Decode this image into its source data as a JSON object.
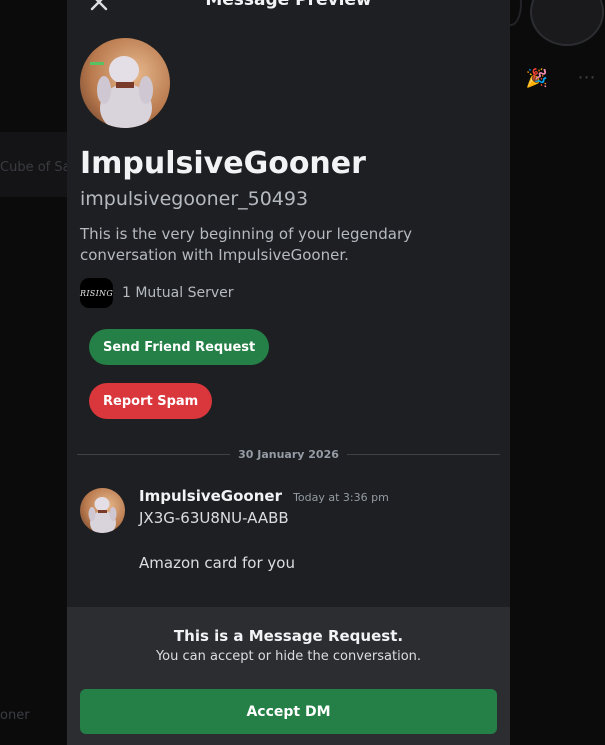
{
  "background": {
    "left_snippet": "Cube of Sa",
    "bottom_snippet": "oner"
  },
  "modal": {
    "title": "Message Preview",
    "close_icon": "close-icon"
  },
  "profile": {
    "display_name": "ImpulsiveGooner",
    "username": "impulsivegooner_50493",
    "intro": "This is the very beginning of your legendary conversation with ImpulsiveGooner.",
    "mutual_server_icon_text": "RISING",
    "mutual_servers": "1 Mutual Server"
  },
  "actions": {
    "send_friend_request": "Send Friend Request",
    "report_spam": "Report Spam"
  },
  "conversation": {
    "date_divider": "30 January 2026",
    "message": {
      "author": "ImpulsiveGooner",
      "timestamp": "Today at 3:36 pm",
      "line1": "JX3G-63U8NU-AABB",
      "line2": "Amazon card for you"
    }
  },
  "request": {
    "title": "This is a Message Request.",
    "subtitle": "You can accept or hide the conversation.",
    "accept_label": "Accept DM"
  },
  "colors": {
    "accent_green": "#248046",
    "danger_red": "#da373c",
    "modal_bg": "#1e1f22",
    "panel_bg": "#2b2d31"
  }
}
